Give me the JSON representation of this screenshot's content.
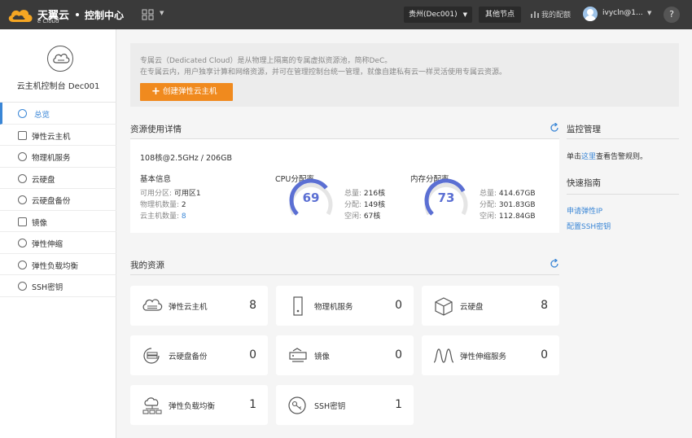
{
  "topbar": {
    "brand": "天翼云",
    "brand_sub": "e Cloud",
    "console_title": "控制中心",
    "region": "贵州(Dec001)",
    "other_nodes": "其他节点",
    "quota": "我的配额",
    "user": "ivycln@1...",
    "help": "?"
  },
  "sidebar": {
    "title": "云主机控制台 Dec001",
    "items": [
      {
        "label": "总览",
        "icon": "overview-icon"
      },
      {
        "label": "弹性云主机",
        "icon": "ecs-icon"
      },
      {
        "label": "物理机服务",
        "icon": "physical-machine-icon"
      },
      {
        "label": "云硬盘",
        "icon": "disk-icon"
      },
      {
        "label": "云硬盘备份",
        "icon": "disk-backup-icon"
      },
      {
        "label": "镜像",
        "icon": "image-icon"
      },
      {
        "label": "弹性伸缩",
        "icon": "autoscaling-icon"
      },
      {
        "label": "弹性负载均衡",
        "icon": "load-balancer-icon"
      },
      {
        "label": "SSH密钥",
        "icon": "ssh-key-icon"
      }
    ]
  },
  "banner": {
    "line1": "专属云（Dedicated Cloud）是从物理上隔离的专属虚拟资源池，简称DeC。",
    "line2": "在专属云内，用户独享计算和网络资源，并可在管理控制台统一管理，就像自建私有云一样灵活使用专属云资源。",
    "create_button": "创建弹性云主机"
  },
  "usage": {
    "title": "资源使用详情",
    "summary": "108核@2.5GHz / 206GB",
    "basic": {
      "title": "基本信息",
      "zone_label": "可用分区:",
      "zone_value": "可用区1",
      "pm_label": "物理机数量:",
      "pm_value": "2",
      "vm_label": "云主机数量:",
      "vm_value": "8"
    },
    "cpu": {
      "title": "CPU分配率",
      "percent": 69,
      "percent_text": "69",
      "total_label": "总量:",
      "total": "216核",
      "alloc_label": "分配:",
      "alloc": "149核",
      "free_label": "空闲:",
      "free": "67核"
    },
    "mem": {
      "title": "内存分配率",
      "percent": 73,
      "percent_text": "73",
      "total_label": "总量:",
      "total": "414.67GB",
      "alloc_label": "分配:",
      "alloc": "301.83GB",
      "free_label": "空闲:",
      "free": "112.84GB"
    }
  },
  "monitor": {
    "title": "监控管理",
    "text_prefix": "单击",
    "text_link": "这里",
    "text_suffix": "查看告警规则。"
  },
  "guide": {
    "title": "快速指南",
    "links": [
      "申请弹性IP",
      "配置SSH密钥"
    ]
  },
  "resources": {
    "title": "我的资源",
    "cards": [
      {
        "label": "弹性云主机",
        "count": "8",
        "icon": "ecs-icon"
      },
      {
        "label": "物理机服务",
        "count": "0",
        "icon": "physical-machine-icon"
      },
      {
        "label": "云硬盘",
        "count": "8",
        "icon": "disk-icon"
      },
      {
        "label": "云硬盘备份",
        "count": "0",
        "icon": "disk-backup-icon"
      },
      {
        "label": "镜像",
        "count": "0",
        "icon": "image-icon"
      },
      {
        "label": "弹性伸缩服务",
        "count": "0",
        "icon": "autoscaling-icon"
      },
      {
        "label": "弹性负载均衡",
        "count": "1",
        "icon": "load-balancer-icon"
      },
      {
        "label": "SSH密钥",
        "count": "1",
        "icon": "ssh-key-icon"
      }
    ]
  },
  "colors": {
    "topbar": "#3a3a3a",
    "accent": "#3a86d6",
    "orange": "#f08a1e",
    "gauge": "#5b6fd3"
  }
}
